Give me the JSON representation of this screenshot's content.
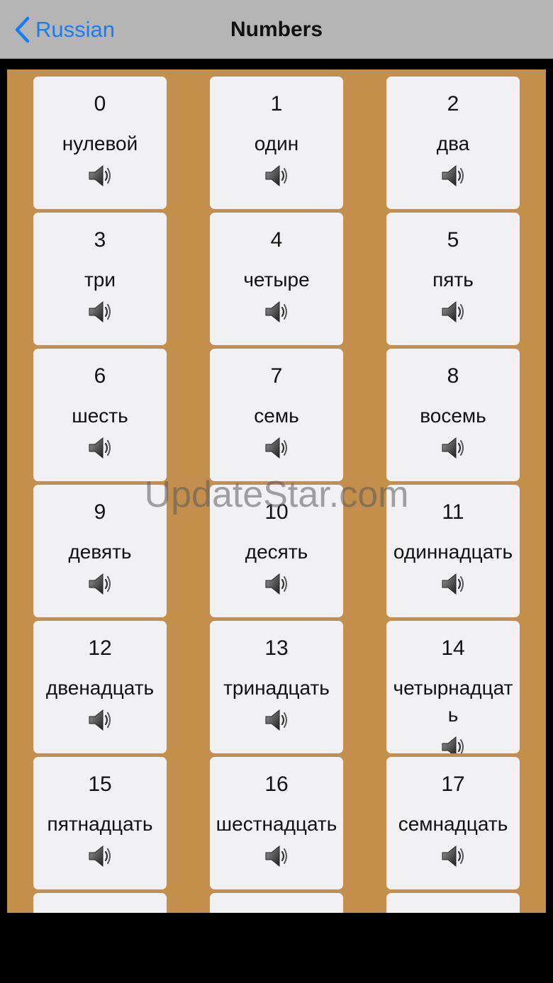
{
  "navbar": {
    "back_label": "Russian",
    "title": "Numbers"
  },
  "colors": {
    "board": "#c48f4c",
    "card": "#f1f1f4",
    "accent": "#1a7cf5",
    "navbar": "#b5b5b5"
  },
  "watermark": "UpdateStar.com",
  "cards": [
    {
      "number": "0",
      "word": "нулевой",
      "icon": "speaker-icon"
    },
    {
      "number": "1",
      "word": "один",
      "icon": "speaker-icon"
    },
    {
      "number": "2",
      "word": "два",
      "icon": "speaker-icon"
    },
    {
      "number": "3",
      "word": "три",
      "icon": "speaker-icon"
    },
    {
      "number": "4",
      "word": "четыре",
      "icon": "speaker-icon"
    },
    {
      "number": "5",
      "word": "пять",
      "icon": "speaker-icon"
    },
    {
      "number": "6",
      "word": "шесть",
      "icon": "speaker-icon"
    },
    {
      "number": "7",
      "word": "семь",
      "icon": "speaker-icon"
    },
    {
      "number": "8",
      "word": "восемь",
      "icon": "speaker-icon"
    },
    {
      "number": "9",
      "word": "девять",
      "icon": "speaker-icon"
    },
    {
      "number": "10",
      "word": "десять",
      "icon": "speaker-icon"
    },
    {
      "number": "11",
      "word": "одиннадцать",
      "icon": "speaker-icon"
    },
    {
      "number": "12",
      "word": "двенадцать",
      "icon": "speaker-icon"
    },
    {
      "number": "13",
      "word": "тринадцать",
      "icon": "speaker-icon"
    },
    {
      "number": "14",
      "word": "четырнадцать",
      "icon": "speaker-icon"
    },
    {
      "number": "15",
      "word": "пятнадцать",
      "icon": "speaker-icon"
    },
    {
      "number": "16",
      "word": "шестнадцать",
      "icon": "speaker-icon"
    },
    {
      "number": "17",
      "word": "семнадцать",
      "icon": "speaker-icon"
    },
    {
      "number": "",
      "word": "",
      "icon": "speaker-icon"
    },
    {
      "number": "",
      "word": "",
      "icon": "speaker-icon"
    },
    {
      "number": "",
      "word": "",
      "icon": "speaker-icon"
    }
  ]
}
